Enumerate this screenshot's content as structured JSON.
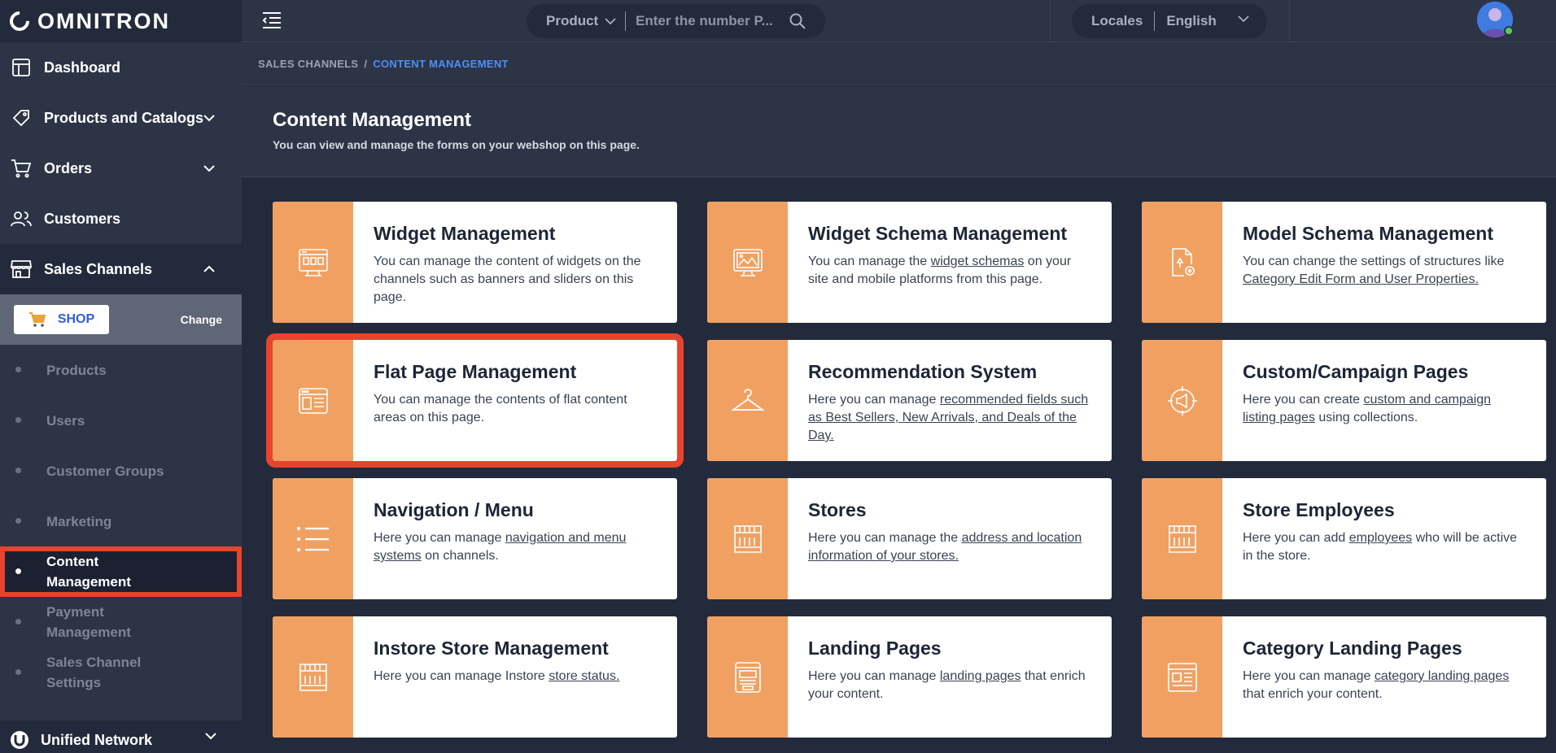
{
  "app": {
    "brand": "OMNITRON"
  },
  "sidebar": {
    "items": [
      {
        "label": "Dashboard",
        "icon": "dashboard-icon"
      },
      {
        "label": "Products and Catalogs",
        "icon": "tag-icon"
      },
      {
        "label": "Orders",
        "icon": "cart-icon"
      },
      {
        "label": "Customers",
        "icon": "users-icon"
      },
      {
        "label": "Sales Channels",
        "icon": "store-icon"
      }
    ],
    "channel": {
      "name": "SHOP",
      "change_label": "Change"
    },
    "sub_items": [
      {
        "label": "Products"
      },
      {
        "label": "Users"
      },
      {
        "label": "Customer Groups"
      },
      {
        "label": "Marketing"
      },
      {
        "label_line1": "Content",
        "label_line2": "Management"
      },
      {
        "label_line1": "Payment",
        "label_line2": "Management"
      },
      {
        "label_line1": "Sales Channel",
        "label_line2": "Settings"
      }
    ],
    "bottom": {
      "label": "Unified Network"
    }
  },
  "topbar": {
    "search_type": "Product",
    "search_placeholder": "Enter the number P...",
    "locale_label": "Locales",
    "locale_value": "English"
  },
  "breadcrumb": {
    "parent": "SALES CHANNELS",
    "separator": "/",
    "current": "CONTENT MANAGEMENT"
  },
  "header": {
    "title": "Content Management",
    "subtitle": "You can view and manage the forms on your webshop on this page."
  },
  "cards": [
    {
      "title": "Widget Management",
      "desc_pre": "You can manage the content of widgets on the channels such as banners and sliders on this page.",
      "link": "",
      "desc_post": "",
      "icon": "widget-icon"
    },
    {
      "title": "Widget Schema Management",
      "desc_pre": "You can manage the ",
      "link": "widget schemas",
      "desc_post": " on your site and mobile platforms from this page.",
      "icon": "monitor-icon"
    },
    {
      "title": "Model Schema Management",
      "desc_pre": "You can change the settings of structures like ",
      "link": "Category Edit Form and User Properties.",
      "desc_post": "",
      "icon": "document-gear-icon"
    },
    {
      "title": "Flat Page Management",
      "desc_pre": "You can manage the contents of flat content areas on this page.",
      "link": "",
      "desc_post": "",
      "icon": "browser-window-icon"
    },
    {
      "title": "Recommendation System",
      "desc_pre": "Here you can manage ",
      "link": "recommended fields such as Best Sellers, New Arrivals, and Deals of the Day.",
      "desc_post": "",
      "icon": "hanger-icon"
    },
    {
      "title": "Custom/Campaign Pages",
      "desc_pre": "Here you can create ",
      "link": "custom and campaign listing pages",
      "desc_post": " using collections.",
      "icon": "megaphone-icon"
    },
    {
      "title": "Navigation / Menu",
      "desc_pre": "Here you can manage ",
      "link": "navigation and menu systems",
      "desc_post": " on channels.",
      "icon": "list-icon"
    },
    {
      "title": "Stores",
      "desc_pre": "Here you can manage the ",
      "link": "address and location information of your stores.",
      "desc_post": "",
      "icon": "storefront-icon"
    },
    {
      "title": "Store Employees",
      "desc_pre": "Here you can add ",
      "link": "employees",
      "desc_post": " who will be active in the store.",
      "icon": "storefront-icon"
    },
    {
      "title": "Instore Store Management",
      "desc_pre": "Here you can manage Instore ",
      "link": "store status.",
      "desc_post": "",
      "icon": "storefront-icon"
    },
    {
      "title": "Landing Pages",
      "desc_pre": "Here you can manage ",
      "link": "landing pages",
      "desc_post": " that enrich your content.",
      "icon": "landing-page-icon"
    },
    {
      "title": "Category Landing Pages",
      "desc_pre": "Here you can manage ",
      "link": "category landing pages",
      "desc_post": " that enrich your content.",
      "icon": "category-page-icon"
    }
  ],
  "colors": {
    "accent": "#f0a162",
    "highlight": "#e8432d",
    "link": "#4f8ef7",
    "sidebar_bg": "#2c3446",
    "page_bg": "#232a3b"
  }
}
